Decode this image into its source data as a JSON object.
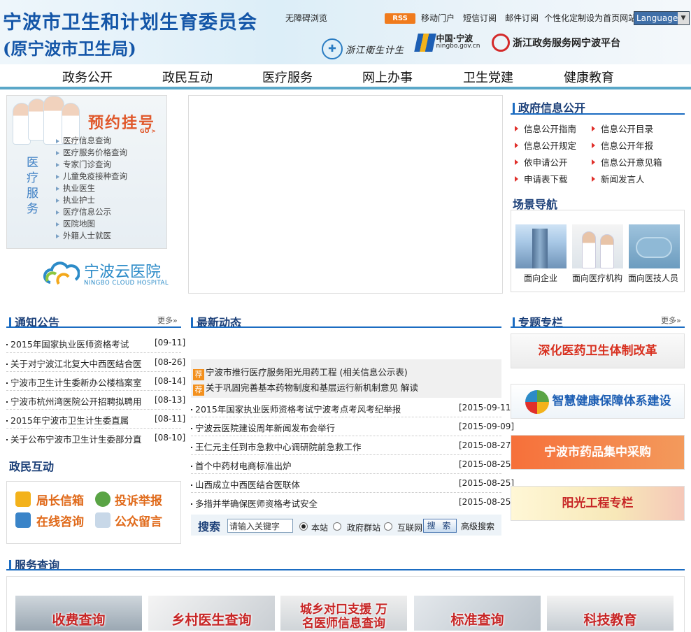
{
  "header": {
    "title": "宁波市卫生和计划生育委员会",
    "subtitle": "(原宁波市卫生局)",
    "top_links": [
      "无障碍浏览",
      "移动门户",
      "短信订阅",
      "邮件订阅",
      "个性化定制",
      "设为首页",
      "网站地图"
    ],
    "rss_label": "RSS",
    "language_select": "Language",
    "partners": [
      {
        "label": "浙江衛生计生",
        "icon": "zhejiang-health-seal-icon"
      },
      {
        "label": "中国·宁波",
        "sub": "ningbo.gov.cn",
        "icon": "ningbo-gov-logo-icon"
      },
      {
        "label": "浙江政务服务网宁波平台",
        "icon": "zhejiang-service-logo-icon"
      }
    ]
  },
  "nav": {
    "items": [
      "政务公开",
      "政民互动",
      "医疗服务",
      "网上办事",
      "卫生党建",
      "健康教育"
    ]
  },
  "medical_panel": {
    "title": "预约挂号",
    "go": "GO >",
    "vertical_label": "医疗服务",
    "links": [
      "医疗信息查询",
      "医疗服务价格查询",
      "专家门诊查询",
      "儿童免疫接种查询",
      "执业医生",
      "执业护士",
      "医疗信息公示",
      "医院地图",
      "外籍人士就医"
    ]
  },
  "cloud_hospital": {
    "name": "宁波云医院",
    "en": "NINGBO CLOUD HOSPITAL"
  },
  "gov_info": {
    "title": "政府信息公开",
    "links": [
      "信息公开指南",
      "信息公开目录",
      "信息公开规定",
      "信息公开年报",
      "依申请公开",
      "信息公开意见箱",
      "申请表下载",
      "新闻发言人"
    ]
  },
  "scene_nav": {
    "title": "场景导航",
    "items": [
      "面向企业",
      "面向医疗机构",
      "面向医技人员"
    ]
  },
  "notices": {
    "title": "通知公告",
    "more": "更多»",
    "items": [
      {
        "text": "2015年国家执业医师资格考试",
        "date": "[09-11]"
      },
      {
        "text": "关于对宁波江北复大中西医结合医",
        "date": "[08-26]"
      },
      {
        "text": "宁波市卫生计生委新办公楼档案室",
        "date": "[08-14]"
      },
      {
        "text": "宁波市杭州湾医院公开招聘拟聘用",
        "date": "[08-13]"
      },
      {
        "text": "2015年宁波市卫生计生委直属",
        "date": "[08-11]"
      },
      {
        "text": "关于公布宁波市卫生计生委部分直",
        "date": "[08-10]"
      }
    ]
  },
  "interaction": {
    "title": "政民互动",
    "items": [
      "局长信箱",
      "投诉举报",
      "在线咨询",
      "公众留言"
    ]
  },
  "news": {
    "title": "最新动态",
    "featured": [
      {
        "badge": "荐",
        "text": "宁波市推行医疗服务阳光用药工程 (相关信息公示表)"
      },
      {
        "badge": "荐",
        "text": "关于巩固完善基本药物制度和基层运行新机制意见 解读"
      }
    ],
    "items": [
      {
        "text": "2015年国家执业医师资格考试宁波考点考风考纪举报",
        "date": "[2015-09-11]"
      },
      {
        "text": "宁波云医院建设周年新闻发布会举行",
        "date": "[2015-09-09]"
      },
      {
        "text": "王仁元主任到市急救中心调研院前急救工作",
        "date": "[2015-08-27]"
      },
      {
        "text": "首个中药材电商标准出炉",
        "date": "[2015-08-25]"
      },
      {
        "text": "山西成立中西医结合医联体",
        "date": "[2015-08-25]"
      },
      {
        "text": "多措并举确保医师资格考试安全",
        "date": "[2015-08-25]"
      }
    ]
  },
  "search": {
    "label": "搜索",
    "placeholder": "请输入关键字",
    "options": [
      "本站",
      "政府群站",
      "互联网"
    ],
    "selected": "本站",
    "button": "搜 索",
    "advanced": "高级搜索"
  },
  "special": {
    "title": "专题专栏",
    "more": "更多»",
    "items": [
      "深化医药卫生体制改革",
      "智慧健康保障体系建设",
      "宁波市药品集中采购",
      "阳光工程专栏"
    ]
  },
  "service": {
    "title": "服务查询",
    "items": [
      "收费查询",
      "乡村医生查询",
      "城乡对口支援 万名医师信息查询",
      "标准查询",
      "科技教育"
    ]
  },
  "colors": {
    "brand_blue": "#1456a8",
    "section_blue": "#1b6cc2",
    "accent_orange": "#e06a1a",
    "accent_red": "#c72626"
  }
}
